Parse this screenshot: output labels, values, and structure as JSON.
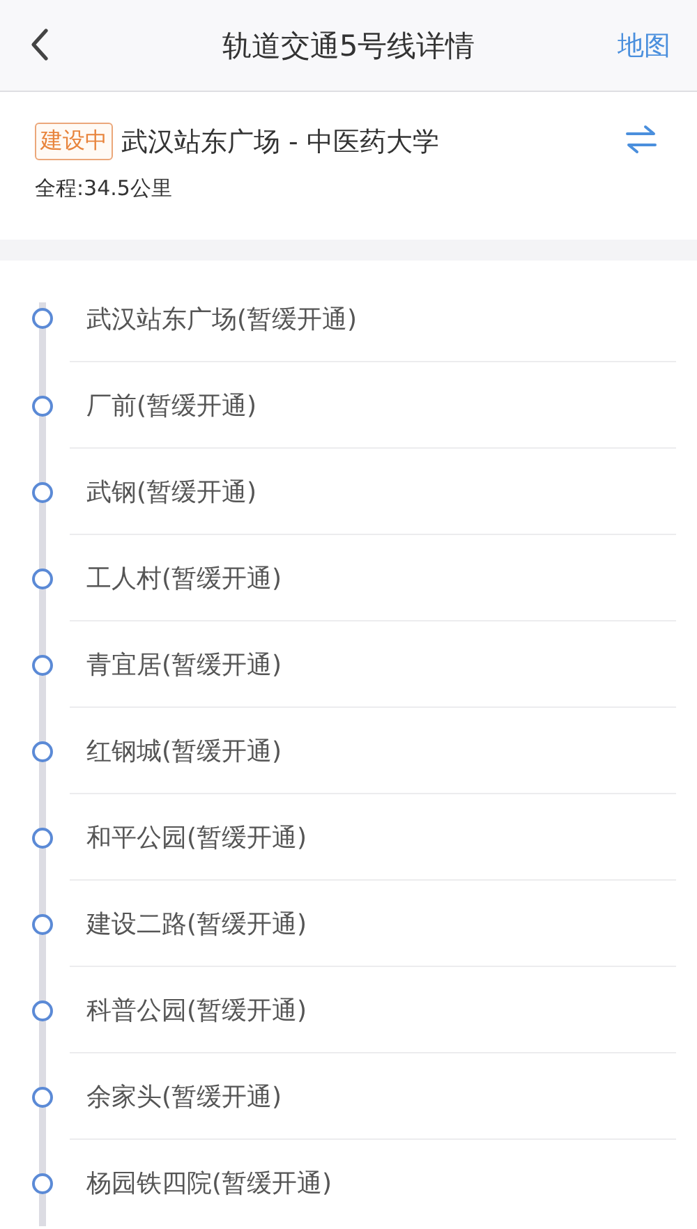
{
  "header": {
    "title": "轨道交通5号线详情",
    "map_link": "地图"
  },
  "line": {
    "status": "建设中",
    "route": "武汉站东广场 - 中医药大学",
    "distance": "全程:34.5公里"
  },
  "stations": [
    {
      "name": "武汉站东广场(暂缓开通)"
    },
    {
      "name": "厂前(暂缓开通)"
    },
    {
      "name": "武钢(暂缓开通)"
    },
    {
      "name": "工人村(暂缓开通)"
    },
    {
      "name": "青宜居(暂缓开通)"
    },
    {
      "name": "红钢城(暂缓开通)"
    },
    {
      "name": "和平公园(暂缓开通)"
    },
    {
      "name": "建设二路(暂缓开通)"
    },
    {
      "name": "科普公园(暂缓开通)"
    },
    {
      "name": "余家头(暂缓开通)"
    },
    {
      "name": "杨园铁四院(暂缓开通)"
    }
  ]
}
